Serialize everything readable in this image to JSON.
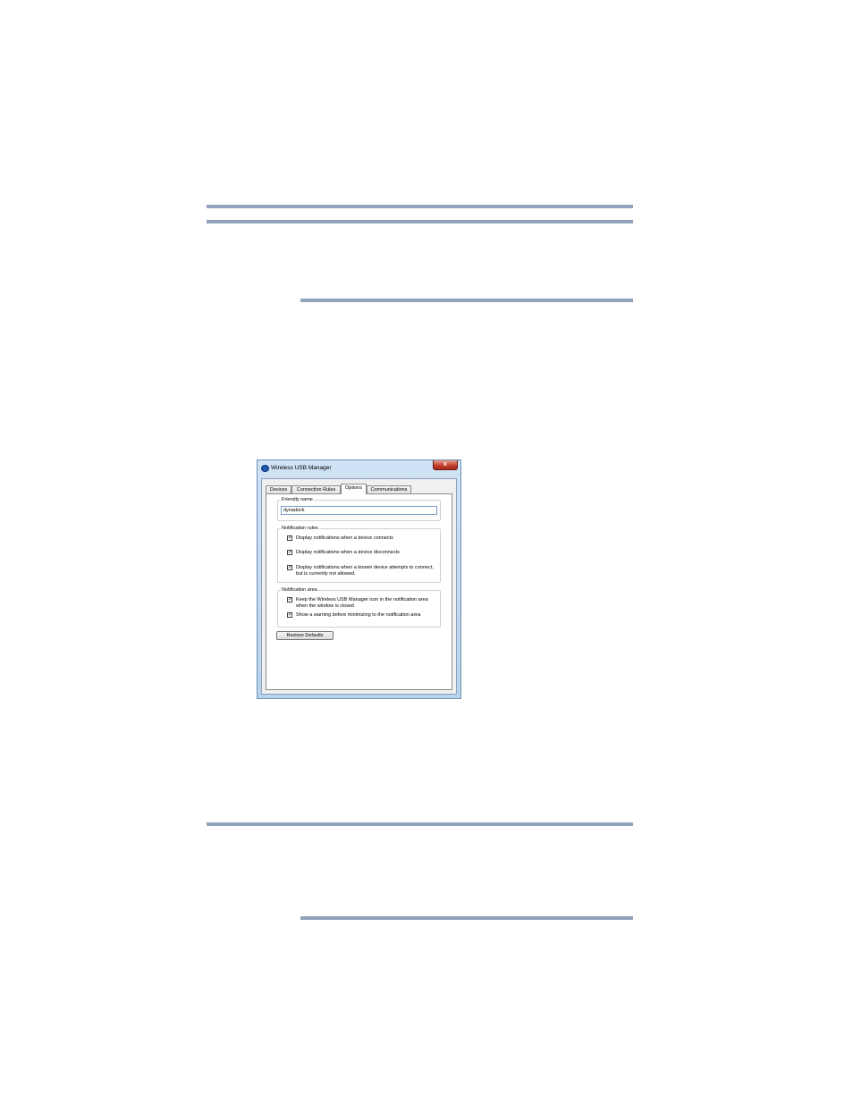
{
  "window": {
    "title": "Wireless USB Manager",
    "close_glyph": "x",
    "icon": "app-icon"
  },
  "tabs": [
    {
      "label": "Devices"
    },
    {
      "label": "Connection Rules"
    },
    {
      "label": "Options"
    },
    {
      "label": "Communications"
    }
  ],
  "active_tab": "Options",
  "friendly_name": {
    "group_label": "Friendly name",
    "value": "dynadock"
  },
  "notification_rules": {
    "group_label": "Notification rules",
    "items": [
      {
        "label": "Display notifications when a device connects",
        "checked": true
      },
      {
        "label": "Display notifications when a device disconnects",
        "checked": true
      },
      {
        "label": "Display notifications when a known device attempts to connect, but is currently not allowed.",
        "checked": true
      }
    ]
  },
  "notification_area": {
    "group_label": "Notification area",
    "items": [
      {
        "label": "Keep the Wireless USB Manager icon in the notification area when the window is closed",
        "checked": true
      },
      {
        "label": "Show a warning before minimizing to the notification area",
        "checked": true
      }
    ]
  },
  "restore_defaults_label": "Restore Defaults",
  "check_glyph": "✓",
  "colors": {
    "rule": "#8fa3bd",
    "window_frame": "#b9d3ec",
    "close_button": "#c0392b"
  }
}
